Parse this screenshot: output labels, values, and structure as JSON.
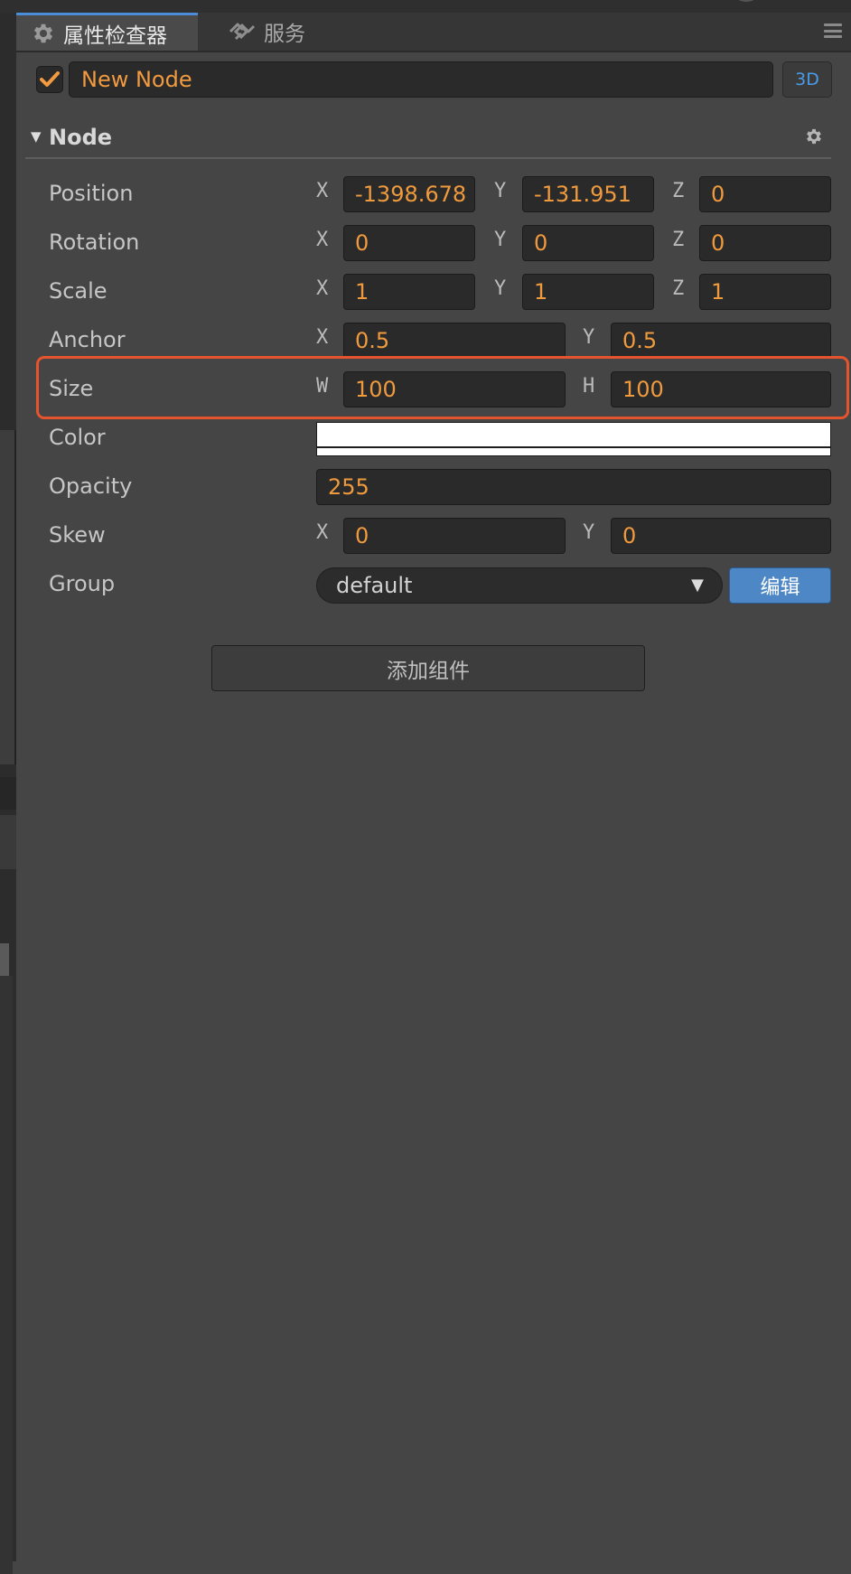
{
  "tabs": [
    {
      "label": "属性检查器",
      "icon": "gear-icon",
      "active": true
    },
    {
      "label": "服务",
      "icon": "service-icon",
      "active": false
    }
  ],
  "node": {
    "enabled": true,
    "name": "New Node",
    "mode_label": "3D"
  },
  "section": {
    "title": "Node",
    "expanded": true
  },
  "properties": {
    "position": {
      "label": "Position",
      "x_label": "X",
      "x": "-1398.678",
      "y_label": "Y",
      "y": "-131.951",
      "z_label": "Z",
      "z": "0"
    },
    "rotation": {
      "label": "Rotation",
      "x_label": "X",
      "x": "0",
      "y_label": "Y",
      "y": "0",
      "z_label": "Z",
      "z": "0"
    },
    "scale": {
      "label": "Scale",
      "x_label": "X",
      "x": "1",
      "y_label": "Y",
      "y": "1",
      "z_label": "Z",
      "z": "1"
    },
    "anchor": {
      "label": "Anchor",
      "x_label": "X",
      "x": "0.5",
      "y_label": "Y",
      "y": "0.5"
    },
    "size": {
      "label": "Size",
      "w_label": "W",
      "w": "100",
      "h_label": "H",
      "h": "100"
    },
    "color": {
      "label": "Color",
      "value": "#ffffff"
    },
    "opacity": {
      "label": "Opacity",
      "value": "255"
    },
    "skew": {
      "label": "Skew",
      "x_label": "X",
      "x": "0",
      "y_label": "Y",
      "y": "0"
    },
    "group": {
      "label": "Group",
      "value": "default",
      "edit_label": "编辑"
    }
  },
  "add_component_label": "添加组件",
  "colors": {
    "accent": "#f19a3f",
    "tab_accent": "#4c8dd9",
    "highlight": "#e6542e",
    "edit_button": "#4d87c5"
  }
}
